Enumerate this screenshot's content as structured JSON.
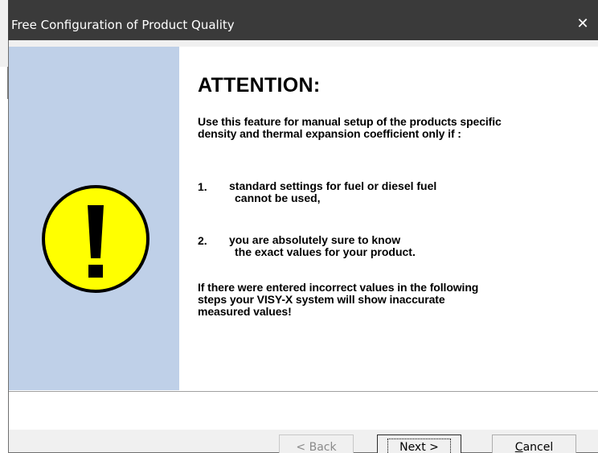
{
  "window": {
    "title": "Free Configuration of Product Quality",
    "close_glyph": "✕"
  },
  "banner": {
    "color": "#bfd0e8",
    "icon": "warning-exclamation-icon",
    "icon_color": "#ffff00",
    "icon_glyph": "!"
  },
  "content": {
    "heading": "ATTENTION:",
    "intro_lines": [
      "Use this feature for manual setup of the products specific",
      "density and thermal expansion coefficient only if :"
    ],
    "items": [
      {
        "number": "1.",
        "lines": [
          "standard settings for fuel or diesel fuel",
          "cannot be used,"
        ]
      },
      {
        "number": "2.",
        "lines": [
          "you are absolutely sure to know",
          "the exact values for your product."
        ]
      }
    ],
    "warning_lines": [
      "If there were entered incorrect values in the following",
      "steps your VISY-X system will show inaccurate",
      "measured values!"
    ]
  },
  "buttons": {
    "back": {
      "label": "< Back",
      "enabled": false
    },
    "next": {
      "label": "Next >",
      "enabled": true
    },
    "cancel": {
      "label_prefix": "C",
      "label_rest": "ancel",
      "enabled": true
    }
  }
}
